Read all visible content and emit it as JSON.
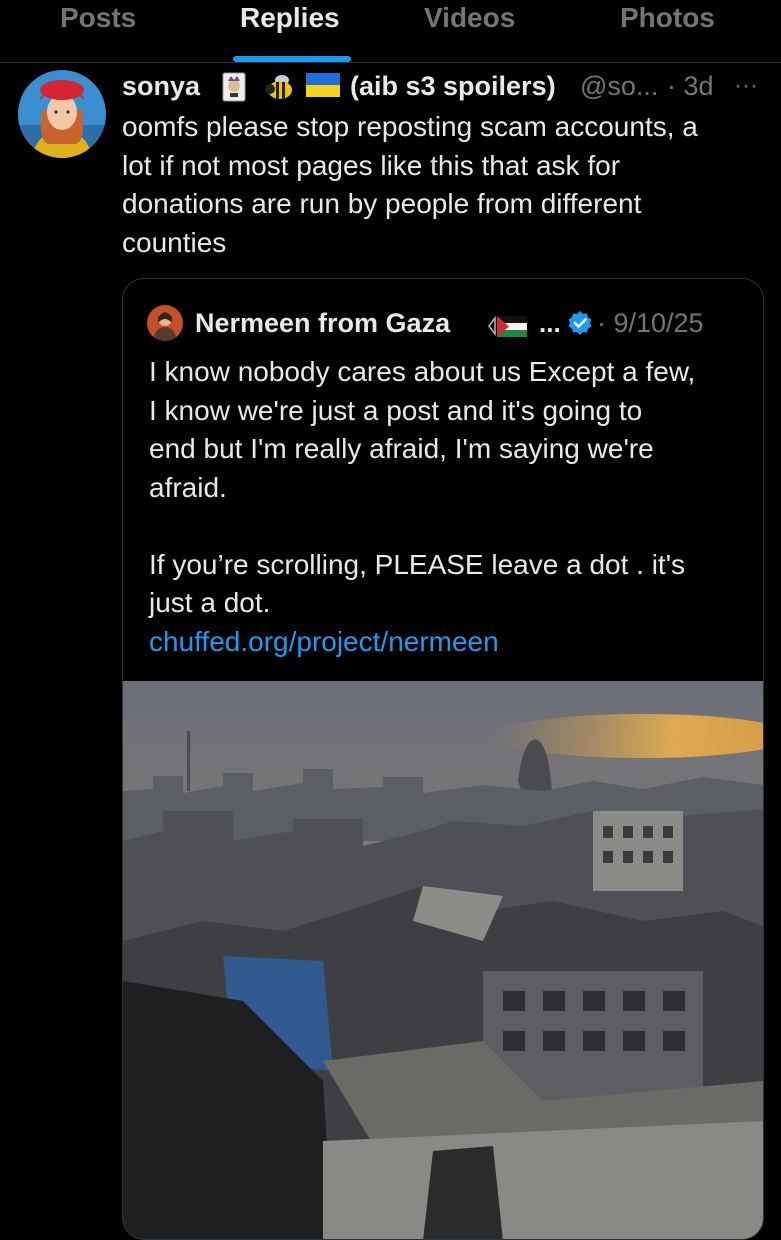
{
  "tabs": [
    {
      "label": "Posts"
    },
    {
      "label": "Replies"
    },
    {
      "label": "Videos"
    },
    {
      "label": "Photos"
    }
  ],
  "active_tab": "Replies",
  "post": {
    "author": "sonya",
    "profile_note": "(aib s3 spoilers)",
    "handle": "@so...",
    "time": "· 3d",
    "more": "···",
    "text_lines": [
      "oomfs please stop reposting scam accounts, a",
      "lot if not most pages like this that ask for",
      "donations are run by people from different",
      "counties"
    ],
    "name_emoji_icons": [
      "joker-card-icon",
      "bee-icon",
      "ukraine-flag-icon"
    ]
  },
  "quote": {
    "author": "Nermeen from Gaza",
    "ellipsis": "...",
    "date": "· 9/10/25",
    "text_lines_1": [
      "I know nobody cares about us Except a few,",
      "I know we're just a post and it's going to",
      "end but I'm really afraid, I'm saying we're",
      "afraid."
    ],
    "text_lines_2": [
      "If you’re scrolling, PLEASE leave a dot . it's",
      "just a dot."
    ],
    "link": "chuffed.org/project/nermeen",
    "media_icon": "destroyed-city-photo",
    "colors": {
      "link": "#1d9bf0",
      "verified": "#1d9bf0"
    }
  }
}
